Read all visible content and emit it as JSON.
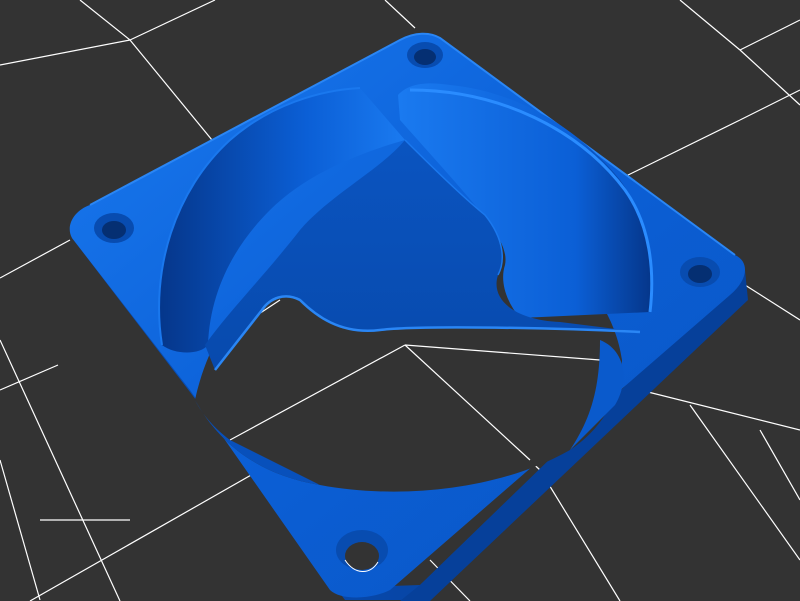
{
  "viewport": {
    "background_color": "#333333",
    "grid_line_color": "#ffffff",
    "grid_visible": true
  },
  "model": {
    "type": "fan-grill-shroud",
    "mounting_holes": 4,
    "vanes": 3,
    "base_color": "#0b5fd6",
    "highlight_color": "#1a7af0",
    "shadow_color": "#063c92"
  }
}
